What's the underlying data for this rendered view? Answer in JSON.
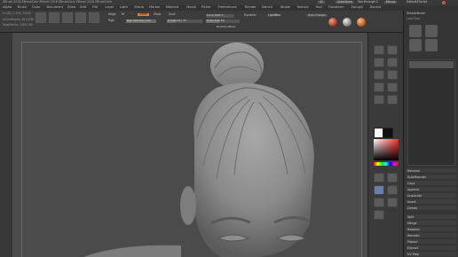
{
  "titlebar": {
    "title": "ZBrush 2018   ZBrushCore   ZBrush 2018   ZBrushCore   ZBrush 2018   ZBrushCore",
    "buttons": [
      "AC",
      "QuickSave",
      "See-through 0",
      "Menus",
      "DefaultZScript"
    ]
  },
  "menus": [
    "Alpha",
    "Brush",
    "Color",
    "Document",
    "Draw",
    "Edit",
    "File",
    "Layer",
    "Light",
    "Macro",
    "Marker",
    "Material",
    "Movie",
    "Picker",
    "Preferences",
    "Render",
    "Stencil",
    "Stroke",
    "Texture",
    "Tool",
    "Transform",
    "Zplugin",
    "Zscript"
  ],
  "toolbar": {
    "row1_text": "0.149,-1.176,-0.420",
    "active_points": "ActivePoints: 813,436",
    "total_points": "TotalPoints: 2,852 Mil",
    "mrgb": "Mrgb",
    "rgb": "Rgb",
    "m_label": "M",
    "zadd": "Zadd",
    "zsub": "Zsub",
    "zcut": "Zcut",
    "rgb_intensity": "Rgb Intensity 100",
    "z_intensity": "Z Intensity 25",
    "focal_shift": "Focal Shift 0",
    "draw_size": "Draw Size 64",
    "backface_mask": "BackfaceMask",
    "dynamic": "Dynamic",
    "lightbox": "LightBox",
    "auto_groups": "Auto Groups",
    "materials": [
      "SkinShade4",
      "BasicMaterial"
    ]
  },
  "rightshelf": {
    "labels": [
      "Move",
      "Scale",
      "Rotate",
      "PolyF",
      "Transp",
      "Solo",
      "Frame",
      "Persp",
      "Floor",
      "Local",
      "Xpose",
      "Dynamic"
    ]
  },
  "rightpanel": {
    "header": "SimpleBrush",
    "subheader": "Load Tool",
    "items": [
      "Rename",
      "AutoReorder",
      "All Low",
      "All High",
      "Copy",
      "Paste",
      "Append",
      "Duplicate",
      "Insert",
      "Delete",
      "Del Other",
      "Split",
      "Merge",
      "Boolean",
      "Remesh",
      "Project",
      "Extract",
      "UV Map"
    ],
    "sections": [
      "Subtool",
      "Geometry",
      "Layers"
    ],
    "stats": [
      "Active 0",
      "Total 0",
      "Merge 24"
    ]
  },
  "colors": {
    "accent": "#e9823a",
    "canvas": "#4b4b4b"
  }
}
